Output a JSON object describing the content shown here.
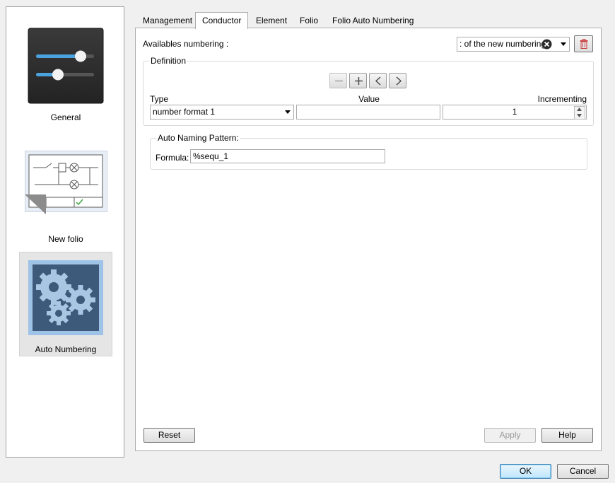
{
  "sidebar": {
    "items": [
      {
        "label": "General",
        "icon": "sliders-icon"
      },
      {
        "label": "New folio",
        "icon": "folio-schematic-icon"
      },
      {
        "label": "Auto Numbering",
        "icon": "gears-icon",
        "selected": true
      }
    ]
  },
  "tabs": [
    {
      "label": "Management"
    },
    {
      "label": "Conductor",
      "active": true
    },
    {
      "label": "Element"
    },
    {
      "label": "Folio"
    },
    {
      "label": "Folio Auto Numbering"
    }
  ],
  "numbering": {
    "label": "Availables numbering :",
    "value": ": of the new numbering"
  },
  "definition": {
    "title": "Definition",
    "columns": {
      "type": "Type",
      "value": "Value",
      "incrementing": "Incrementing"
    },
    "row": {
      "type": "number format 1",
      "value": "",
      "incrementing": "1"
    }
  },
  "pattern": {
    "title": "Auto Naming Pattern:",
    "formula_label": "Formula:",
    "formula_value": "%sequ_1"
  },
  "buttons": {
    "reset": "Reset",
    "apply": "Apply",
    "help": "Help",
    "ok": "OK",
    "cancel": "Cancel"
  },
  "colors": {
    "accent": "#3c7fb1",
    "delete_red": "#c83c3c",
    "gear_bg": "#3d5a7a"
  }
}
